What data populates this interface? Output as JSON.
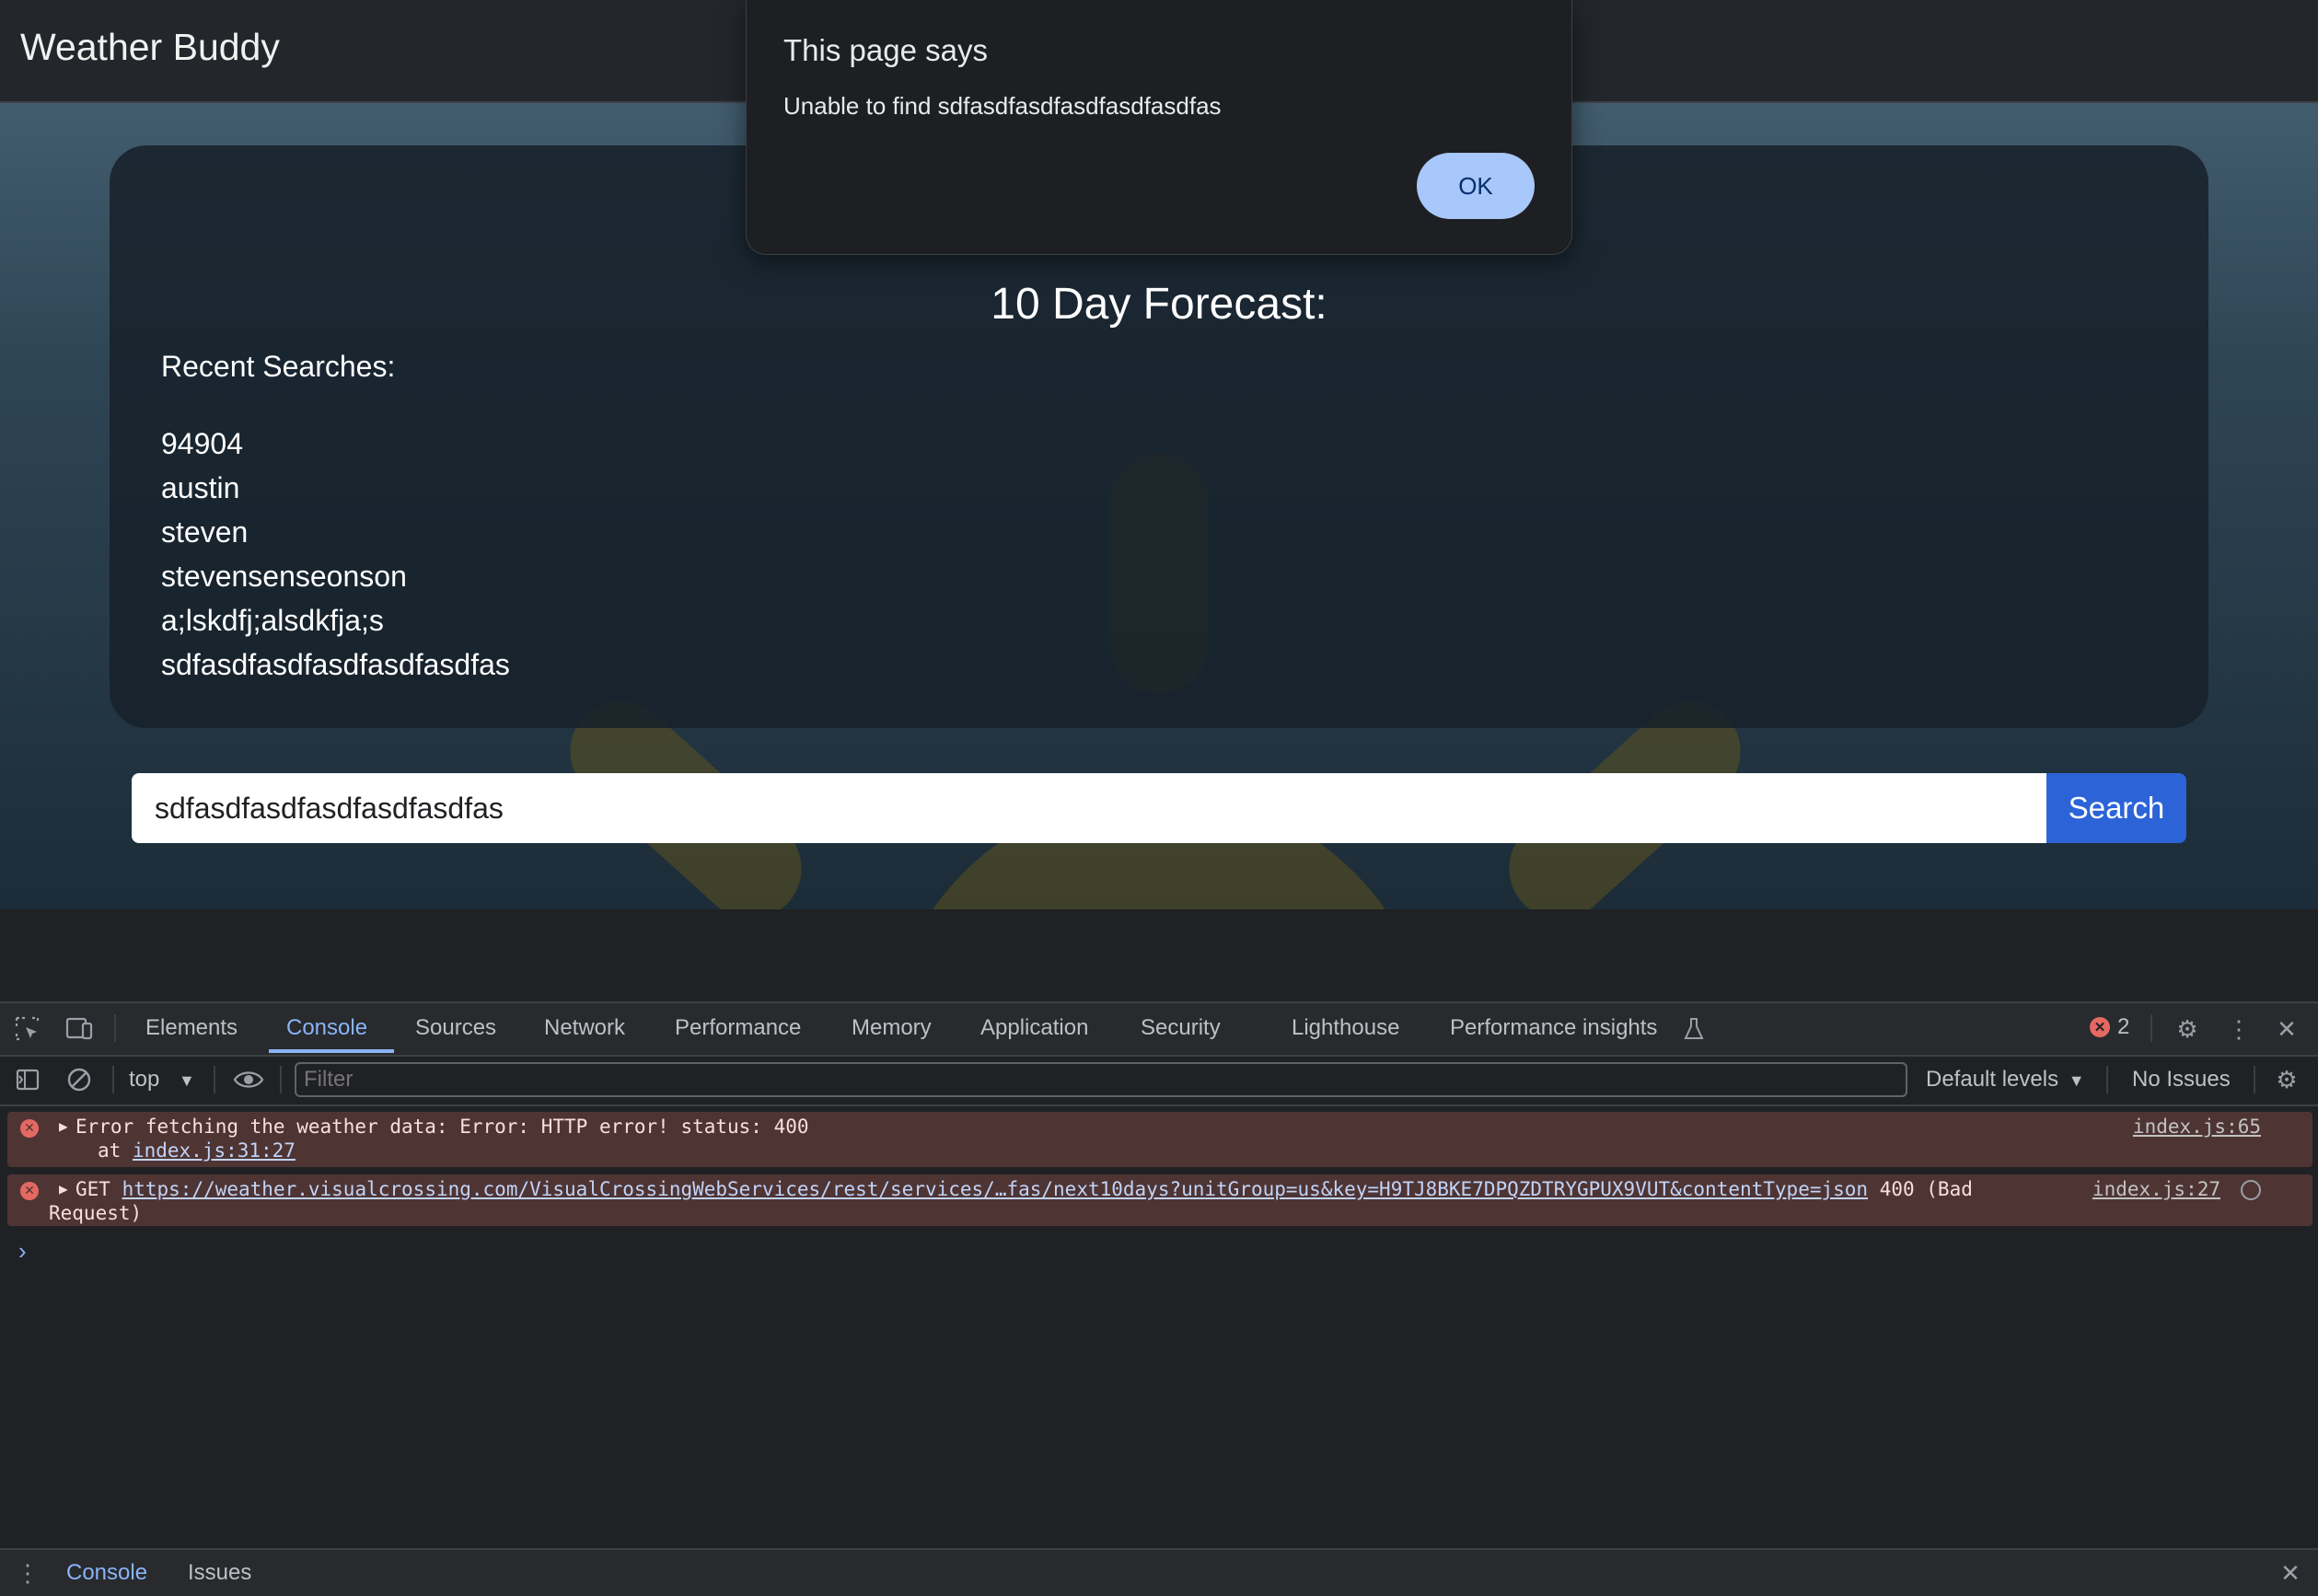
{
  "app": {
    "title": "Weather Buddy"
  },
  "main": {
    "forecast_title": "10 Day Forecast:",
    "recent_label": "Recent Searches:",
    "recent_searches": [
      "94904",
      "austin",
      "steven",
      "stevensenseonson",
      "a;lskdfj;alsdkfja;s",
      "sdfasdfasdfasdfasdfasdfas"
    ],
    "search_value": "sdfasdfasdfasdfasdfasdfas",
    "search_button": "Search"
  },
  "dialog": {
    "title": "This page says",
    "message": "Unable to find sdfasdfasdfasdfasdfasdfas",
    "ok_label": "OK"
  },
  "devtools": {
    "tabs": [
      "Elements",
      "Console",
      "Sources",
      "Network",
      "Performance",
      "Memory",
      "Application",
      "Security",
      "Lighthouse",
      "Performance insights"
    ],
    "active_tab": "Console",
    "error_count": "2",
    "context": "top",
    "filter_placeholder": "Filter",
    "levels": "Default levels",
    "issues": "No Issues",
    "messages": [
      {
        "text": "Error fetching the weather data: Error: HTTP error! status: 400",
        "at_prefix": "at ",
        "at_link": "index.js:31:27",
        "source": "index.js:65"
      },
      {
        "method": "GET",
        "url": "https://weather.visualcrossing.com/VisualCrossingWebServices/rest/services/…fas/next10days?unitGroup=us&key=H9TJ8BKE7DPQZDTRYGPUX9VUT&contentType=json",
        "status": "400 (Bad",
        "status_cont": "Request)",
        "source": "index.js:27"
      }
    ],
    "drawer_tabs": [
      "Console",
      "Issues"
    ]
  },
  "colors": {
    "accent": "#8ab4f8",
    "search_button": "#2c64d8",
    "error_bg": "#4e3534",
    "sun": "#6b5a14"
  }
}
